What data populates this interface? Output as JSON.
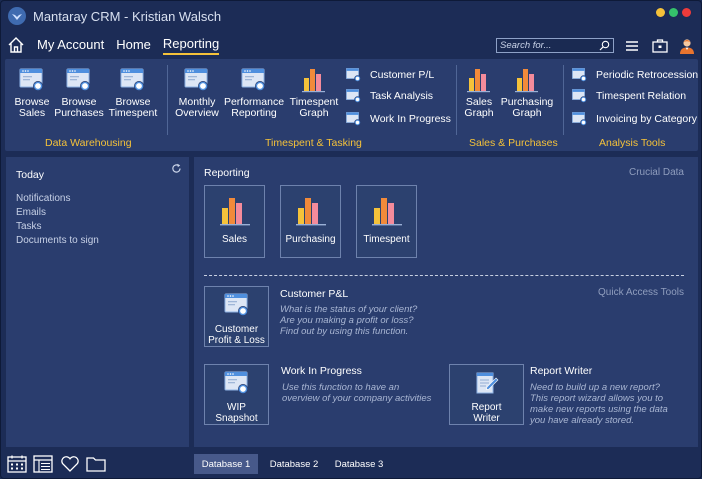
{
  "window": {
    "title": "Mantaray CRM - Kristian Walsch",
    "controls": {
      "minimize_color": "#f5c23a",
      "maximize_color": "#35c26b",
      "close_color": "#ee3b3b"
    }
  },
  "nav": {
    "items": [
      {
        "label": "My Account"
      },
      {
        "label": "Home"
      },
      {
        "label": "Reporting",
        "active": true
      }
    ],
    "search_placeholder": "Search for..."
  },
  "ribbon": {
    "groups": [
      {
        "label": "Data Warehousing"
      },
      {
        "label": "Timespent & Tasking"
      },
      {
        "label": "Sales & Purchases"
      },
      {
        "label": "Analysis Tools"
      }
    ],
    "buttons": {
      "browse_sales": "Browse\nSales",
      "browse_purchases": "Browse\nPurchases",
      "browse_timespent": "Browse\nTimespent",
      "monthly_overview": "Monthly\nOverview",
      "performance_reporting": "Performance\nReporting",
      "timespent_graph": "Timespent\nGraph",
      "customer_pl": "Customer P/L",
      "task_analysis": "Task Analysis",
      "work_in_progress": "Work In Progress",
      "sales_graph": "Sales\nGraph",
      "purchasing_graph": "Purchasing\nGraph",
      "periodic_retrocession": "Periodic Retrocession",
      "timespent_relation": "Timespent Relation",
      "invoicing_by_category": "Invoicing by Category"
    }
  },
  "today": {
    "title": "Today",
    "items": [
      "Notifications",
      "Emails",
      "Tasks",
      "Documents to sign"
    ]
  },
  "reporting": {
    "title": "Reporting",
    "subtitle": "Crucial Data",
    "tiles": [
      {
        "label": "Sales"
      },
      {
        "label": "Purchasing"
      },
      {
        "label": "Timespent"
      }
    ],
    "quick_access_label": "Quick Access Tools",
    "quick_access": {
      "customer_pl": {
        "tile": "Customer\nProfit & Loss",
        "title": "Customer P&L",
        "desc": "What is the status of your client?\nAre you making a profit or loss?\nFind out by using this function."
      },
      "wip": {
        "tile": "WIP\nSnapshot",
        "title": "Work In Progress",
        "desc": "Use this function to have an\noverview of your company activities"
      },
      "report_writer": {
        "tile": "Report\nWriter",
        "title": "Report Writer",
        "desc": "Need to build up a new report?\nThis report wizard allows you to\nmake new reports using the data\nyou have already stored."
      }
    }
  },
  "databases": [
    {
      "label": "Database 1",
      "active": true
    },
    {
      "label": "Database 2"
    },
    {
      "label": "Database 3"
    }
  ],
  "colors": {
    "accent": "#f5c23a",
    "background": "#1c2c56",
    "panel": "#2a3d6e",
    "chart_yellow": "#f5c23a",
    "chart_orange": "#f28a3a",
    "chart_pink": "#f48b9b",
    "chart_blue": "#7fb8ee"
  }
}
